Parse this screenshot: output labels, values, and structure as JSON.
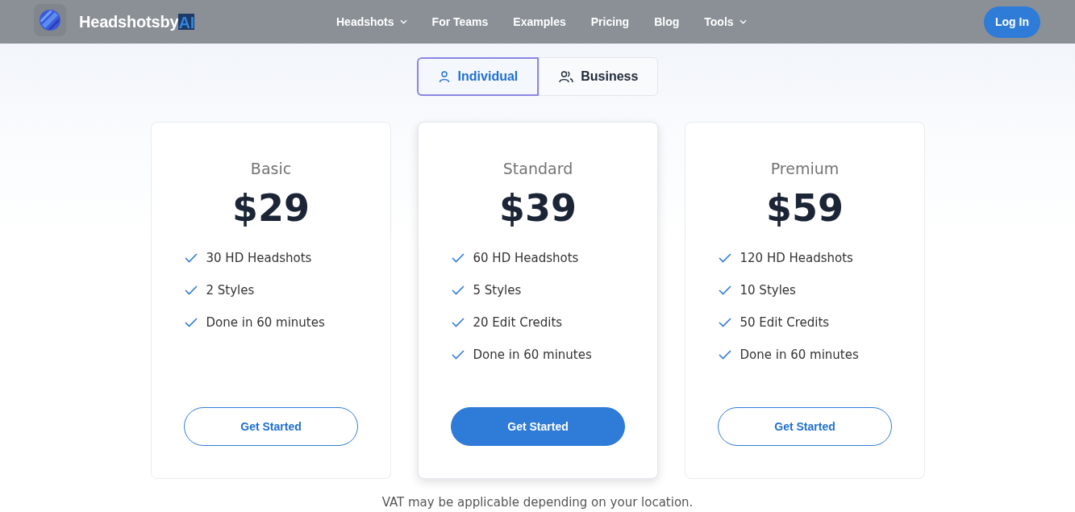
{
  "header": {
    "brand": {
      "name": "Headshotsby",
      "suffix": "AI"
    },
    "nav": [
      {
        "label": "Headshots",
        "has_menu": true
      },
      {
        "label": "For Teams",
        "has_menu": false
      },
      {
        "label": "Examples",
        "has_menu": false
      },
      {
        "label": "Pricing",
        "has_menu": false
      },
      {
        "label": "Blog",
        "has_menu": false
      },
      {
        "label": "Tools",
        "has_menu": true
      }
    ],
    "login": "Log In"
  },
  "plan_toggle": [
    {
      "label": "Individual",
      "kind": "person",
      "selected": true
    },
    {
      "label": "Business",
      "kind": "group",
      "selected": false
    }
  ],
  "plans": [
    {
      "name": "Basic",
      "price": "$29",
      "featured": false,
      "features": [
        "30 HD Headshots",
        "2 Styles",
        "Done in 60 minutes"
      ],
      "button": "Get Started"
    },
    {
      "name": "Standard",
      "price": "$39",
      "featured": true,
      "features": [
        "60 HD Headshots",
        "5 Styles",
        "20 Edit Credits",
        "Done in 60 minutes"
      ],
      "button": "Get Started"
    },
    {
      "name": "Premium",
      "price": "$59",
      "featured": false,
      "features": [
        "120 HD Headshots",
        "10 Styles",
        "50 Edit Credits",
        "Done in 60 minutes"
      ],
      "button": "Get Started"
    }
  ],
  "note": "VAT may be applicable depending on your location."
}
